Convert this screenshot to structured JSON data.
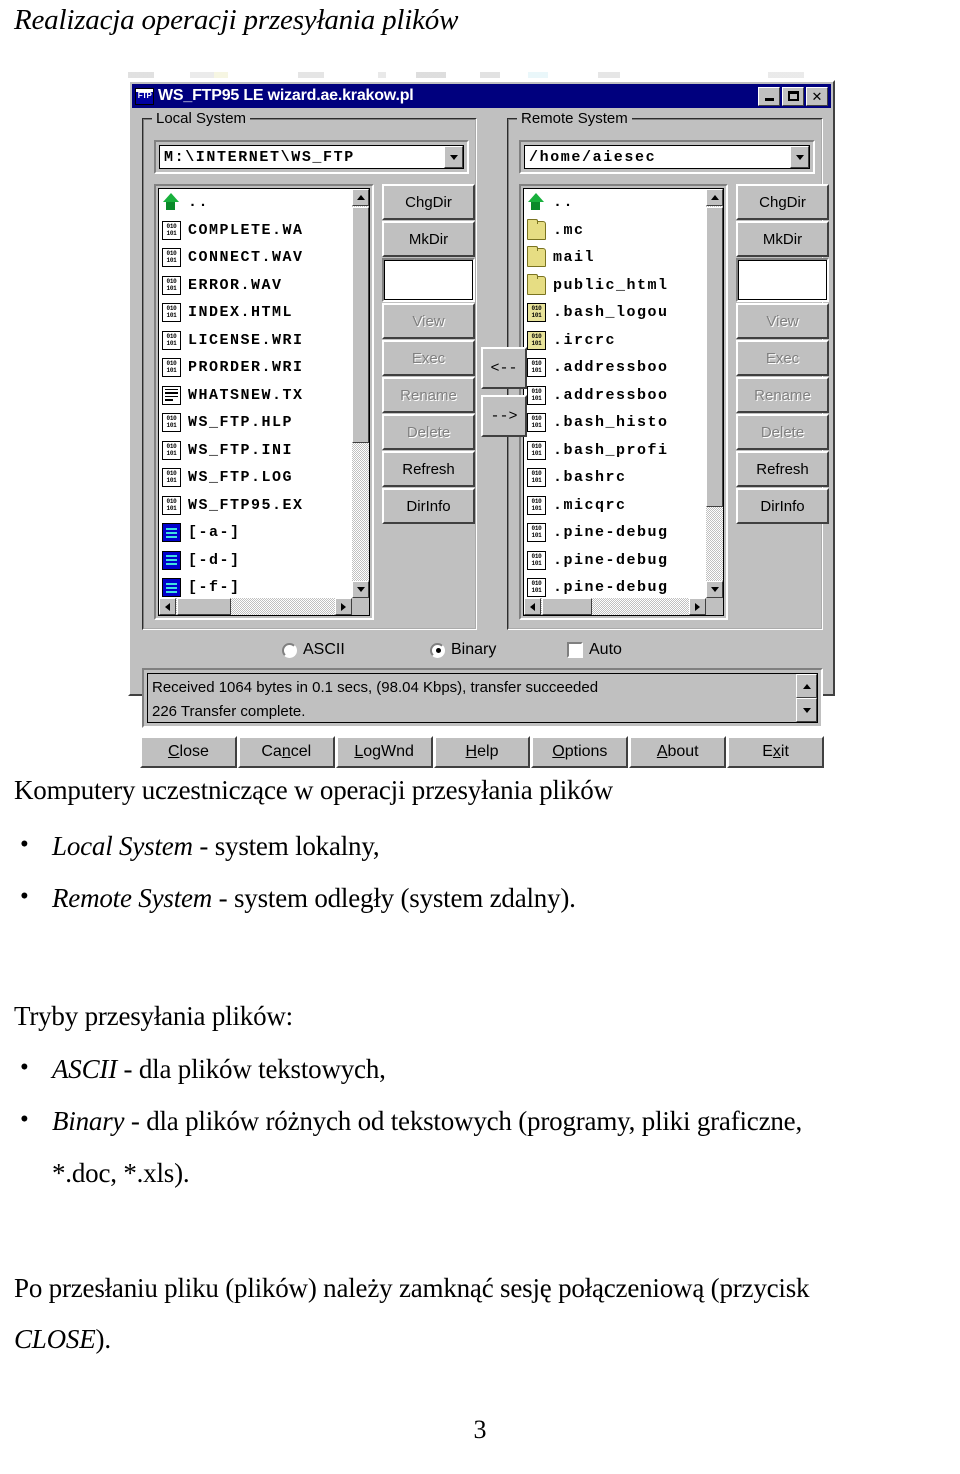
{
  "document": {
    "title": "Realizacja operacji przesyłania plików",
    "page_number": "3",
    "paragraphs": {
      "heading_computers": "Komputery uczestniczące w operacji przesyłania plików",
      "bullet_local_em": "Local System",
      "bullet_local_rest": " - system lokalny,",
      "bullet_remote_em": "Remote System",
      "bullet_remote_rest": " - system odległy (system zdalny).",
      "heading_modes": "Tryby przesyłania plików:",
      "bullet_ascii_em": "ASCII",
      "bullet_ascii_rest": " - dla plików tekstowych,",
      "bullet_binary_em": "Binary",
      "bullet_binary_rest": " - dla plików różnych od tekstowych (programy, pliki graficzne,",
      "bullet_binary_line2": "*.doc, *.xls).",
      "closing_line1": "Po przesłaniu pliku (plików) należy zamknąć sesję połączeniową (przycisk",
      "closing_em": "CLOSE",
      "closing_rest": ")."
    }
  },
  "ftp_window": {
    "icon_label": "FTP",
    "title": "WS_FTP95 LE wizard.ae.krakow.pl",
    "titlebar_color": "#00007e",
    "face_color": "#c0c0c0",
    "window_buttons": [
      {
        "name": "minimize",
        "glyph": "_"
      },
      {
        "name": "maximize",
        "glyph": "□"
      },
      {
        "name": "close",
        "glyph": "✕"
      }
    ],
    "local": {
      "legend": "Local System",
      "path": "M:\\INTERNET\\WS_FTP",
      "files": [
        {
          "name": "..",
          "icon": "up-folder-icon"
        },
        {
          "name": "COMPLETE.WA",
          "icon": "binary-file-icon"
        },
        {
          "name": "CONNECT.WAV",
          "icon": "binary-file-icon"
        },
        {
          "name": "ERROR.WAV",
          "icon": "binary-file-icon"
        },
        {
          "name": "INDEX.HTML",
          "icon": "binary-file-icon"
        },
        {
          "name": "LICENSE.WRI",
          "icon": "binary-file-icon"
        },
        {
          "name": "PRORDER.WRI",
          "icon": "binary-file-icon"
        },
        {
          "name": "WHATSNEW.TX",
          "icon": "text-file-icon"
        },
        {
          "name": "WS_FTP.HLP",
          "icon": "binary-file-icon"
        },
        {
          "name": "WS_FTP.INI",
          "icon": "binary-file-icon"
        },
        {
          "name": "WS_FTP.LOG",
          "icon": "binary-file-icon"
        },
        {
          "name": "WS_FTP95.EX",
          "icon": "binary-file-icon"
        },
        {
          "name": "[-a-]",
          "icon": "drive-icon"
        },
        {
          "name": "[-d-]",
          "icon": "drive-icon"
        },
        {
          "name": "[-f-]",
          "icon": "drive-icon"
        }
      ],
      "buttons": [
        {
          "label": "ChgDir",
          "disabled": false
        },
        {
          "label": "MkDir",
          "disabled": false
        },
        {
          "label": "View",
          "disabled": true
        },
        {
          "label": "Exec",
          "disabled": true
        },
        {
          "label": "Rename",
          "disabled": true
        },
        {
          "label": "Delete",
          "disabled": true
        },
        {
          "label": "Refresh",
          "disabled": false
        },
        {
          "label": "DirInfo",
          "disabled": false
        }
      ]
    },
    "remote": {
      "legend": "Remote System",
      "path": "/home/aiesec",
      "files": [
        {
          "name": "..",
          "icon": "up-folder-icon"
        },
        {
          "name": ".mc",
          "icon": "folder-icon"
        },
        {
          "name": "mail",
          "icon": "folder-icon"
        },
        {
          "name": "public_html",
          "icon": "folder-icon"
        },
        {
          "name": ".bash_logou",
          "icon": "binary-file-yellow-icon"
        },
        {
          "name": ".ircrc",
          "icon": "binary-file-yellow-icon"
        },
        {
          "name": ".addressboo",
          "icon": "binary-file-icon"
        },
        {
          "name": ".addressboo",
          "icon": "binary-file-icon"
        },
        {
          "name": ".bash_histo",
          "icon": "binary-file-icon"
        },
        {
          "name": ".bash_profi",
          "icon": "binary-file-icon"
        },
        {
          "name": ".bashrc",
          "icon": "binary-file-icon"
        },
        {
          "name": ".micqrc",
          "icon": "binary-file-icon"
        },
        {
          "name": ".pine-debug",
          "icon": "binary-file-icon"
        },
        {
          "name": ".pine-debug",
          "icon": "binary-file-icon"
        },
        {
          "name": ".pine-debug",
          "icon": "binary-file-icon"
        }
      ],
      "buttons": [
        {
          "label": "ChgDir",
          "disabled": false
        },
        {
          "label": "MkDir",
          "disabled": false
        },
        {
          "label": "View",
          "disabled": true
        },
        {
          "label": "Exec",
          "disabled": true
        },
        {
          "label": "Rename",
          "disabled": true
        },
        {
          "label": "Delete",
          "disabled": true
        },
        {
          "label": "Refresh",
          "disabled": false
        },
        {
          "label": "DirInfo",
          "disabled": false
        }
      ]
    },
    "transfer_buttons": [
      {
        "label": "<--",
        "name": "transfer-to-local-button"
      },
      {
        "label": "-->",
        "name": "transfer-to-remote-button"
      }
    ],
    "transfer_mode": {
      "ascii": {
        "label": "ASCII",
        "selected": false
      },
      "binary": {
        "label": "Binary",
        "selected": true
      },
      "auto": {
        "label": "Auto",
        "checked": false
      }
    },
    "log": {
      "line1": "Received 1064 bytes in 0.1 secs, (98.04 Kbps), transfer succeeded",
      "line2": "226 Transfer complete."
    },
    "bottom_buttons": [
      {
        "pre": "",
        "key": "C",
        "post": "lose"
      },
      {
        "pre": "Ca",
        "key": "n",
        "post": "cel"
      },
      {
        "pre": "",
        "key": "L",
        "post": "ogWnd"
      },
      {
        "pre": "",
        "key": "H",
        "post": "elp"
      },
      {
        "pre": "",
        "key": "O",
        "post": "ptions"
      },
      {
        "pre": "",
        "key": "A",
        "post": "bout"
      },
      {
        "pre": "E",
        "key": "x",
        "post": "it"
      }
    ]
  }
}
